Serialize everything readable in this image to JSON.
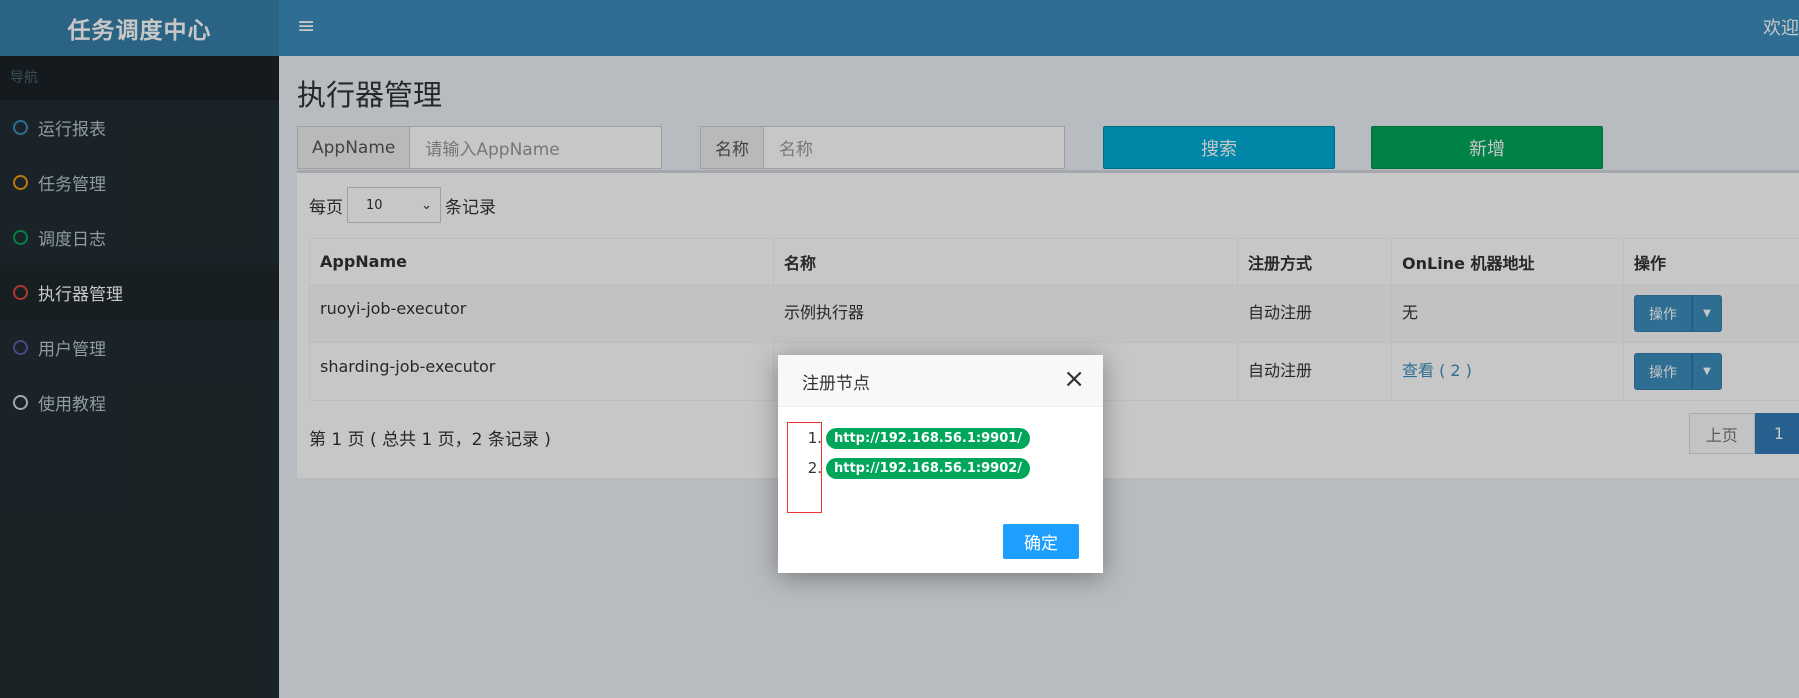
{
  "header": {
    "logo": "任务调度中心",
    "menu_icon": "≡",
    "welcome": "欢迎"
  },
  "sidebar": {
    "nav_header": "导航",
    "items": [
      {
        "label": "运行报表",
        "color": "#3c8dbc"
      },
      {
        "label": "任务管理",
        "color": "#f39c12"
      },
      {
        "label": "调度日志",
        "color": "#00a65a"
      },
      {
        "label": "执行器管理",
        "color": "#dd4b39"
      },
      {
        "label": "用户管理",
        "color": "#605ca8"
      },
      {
        "label": "使用教程",
        "color": "#d2d6de"
      }
    ]
  },
  "main": {
    "title": "执行器管理",
    "filter": {
      "appname_label": "AppName",
      "appname_placeholder": "请输入AppName",
      "name_label": "名称",
      "name_placeholder": "名称",
      "search_label": "搜索",
      "add_label": "新增"
    },
    "per_page": {
      "prefix": "每页",
      "value": "10",
      "suffix": "条记录"
    },
    "table": {
      "headers": [
        "AppName",
        "名称",
        "注册方式",
        "OnLine 机器地址",
        "操作"
      ],
      "rows": [
        {
          "appname": "ruoyi-job-executor",
          "name": "示例执行器",
          "reg": "自动注册",
          "online": "无",
          "op": "操作"
        },
        {
          "appname": "sharding-job-executor",
          "name": "",
          "reg": "自动注册",
          "online": "查看 ( 2 )",
          "op": "操作"
        }
      ]
    },
    "info": "第 1 页 ( 总共 1 页，2 条记录 )",
    "pager": {
      "prev": "上页",
      "current": "1"
    }
  },
  "modal": {
    "title": "注册节点",
    "close": "×",
    "nodes": [
      {
        "num": "1.",
        "url": "http://192.168.56.1:9901/"
      },
      {
        "num": "2.",
        "url": "http://192.168.56.1:9902/"
      }
    ],
    "ok_label": "确定"
  }
}
